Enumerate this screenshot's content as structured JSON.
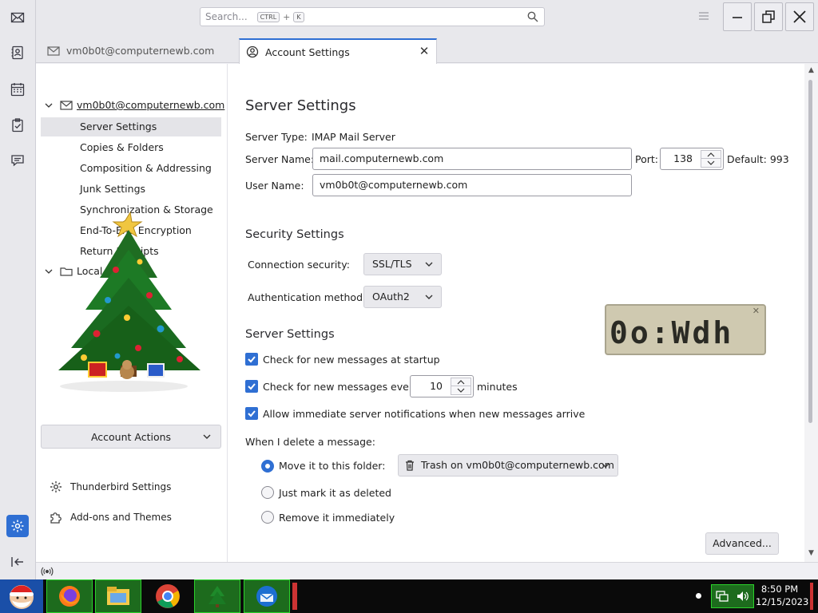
{
  "search": {
    "placeholder": "Search...",
    "shortcut_key1": "CTRL",
    "shortcut_plus": "+",
    "shortcut_key2": "K"
  },
  "tabs": [
    {
      "label": "vm0b0t@computernewb.com",
      "active": false
    },
    {
      "label": "Account Settings",
      "active": true
    }
  ],
  "tree": {
    "account_name": "vm0b0t@computernewb.com",
    "items": [
      "Server Settings",
      "Copies & Folders",
      "Composition & Addressing",
      "Junk Settings",
      "Synchronization & Storage",
      "End-To-End Encryption",
      "Return Receipts"
    ],
    "local_folders": "Local Folders",
    "account_actions": "Account Actions",
    "thunderbird_settings": "Thunderbird Settings",
    "addons_themes": "Add-ons and Themes"
  },
  "settings": {
    "title": "Server Settings",
    "server_type_label": "Server Type:",
    "server_type_value": "IMAP Mail Server",
    "server_name_label": "Server Name:",
    "server_name_value": "mail.computernewb.com",
    "port_label": "Port:",
    "port_value": "138",
    "default_port": "Default: 993",
    "user_name_label": "User Name:",
    "user_name_value": "vm0b0t@computernewb.com",
    "security_heading": "Security Settings",
    "connection_security_label": "Connection security:",
    "connection_security_value": "SSL/TLS",
    "auth_method_label": "Authentication method:",
    "auth_method_value": "OAuth2",
    "server_settings_heading": "Server Settings",
    "check_startup": "Check for new messages at startup",
    "check_every": "Check for new messages every",
    "check_every_value": "10",
    "minutes": "minutes",
    "allow_notifications": "Allow immediate server notifications when new messages arrive",
    "delete_label": "When I delete a message:",
    "move_to_folder": "Move it to this folder:",
    "trash_folder": "Trash on vm0b0t@computernewb.com",
    "just_mark": "Just mark it as deleted",
    "remove_immediately": "Remove it immediately",
    "advanced": "Advanced..."
  },
  "checkboxes": {
    "startup": true,
    "every": true,
    "notifications": true
  },
  "delete_option": "move",
  "lcd_clock": "0o:Wdh",
  "taskbar": {
    "time": "8:50 PM",
    "date": "12/15/2023"
  },
  "colors": {
    "accent": "#2f6fd3",
    "taskbar_highlight": "#2bd32b"
  }
}
